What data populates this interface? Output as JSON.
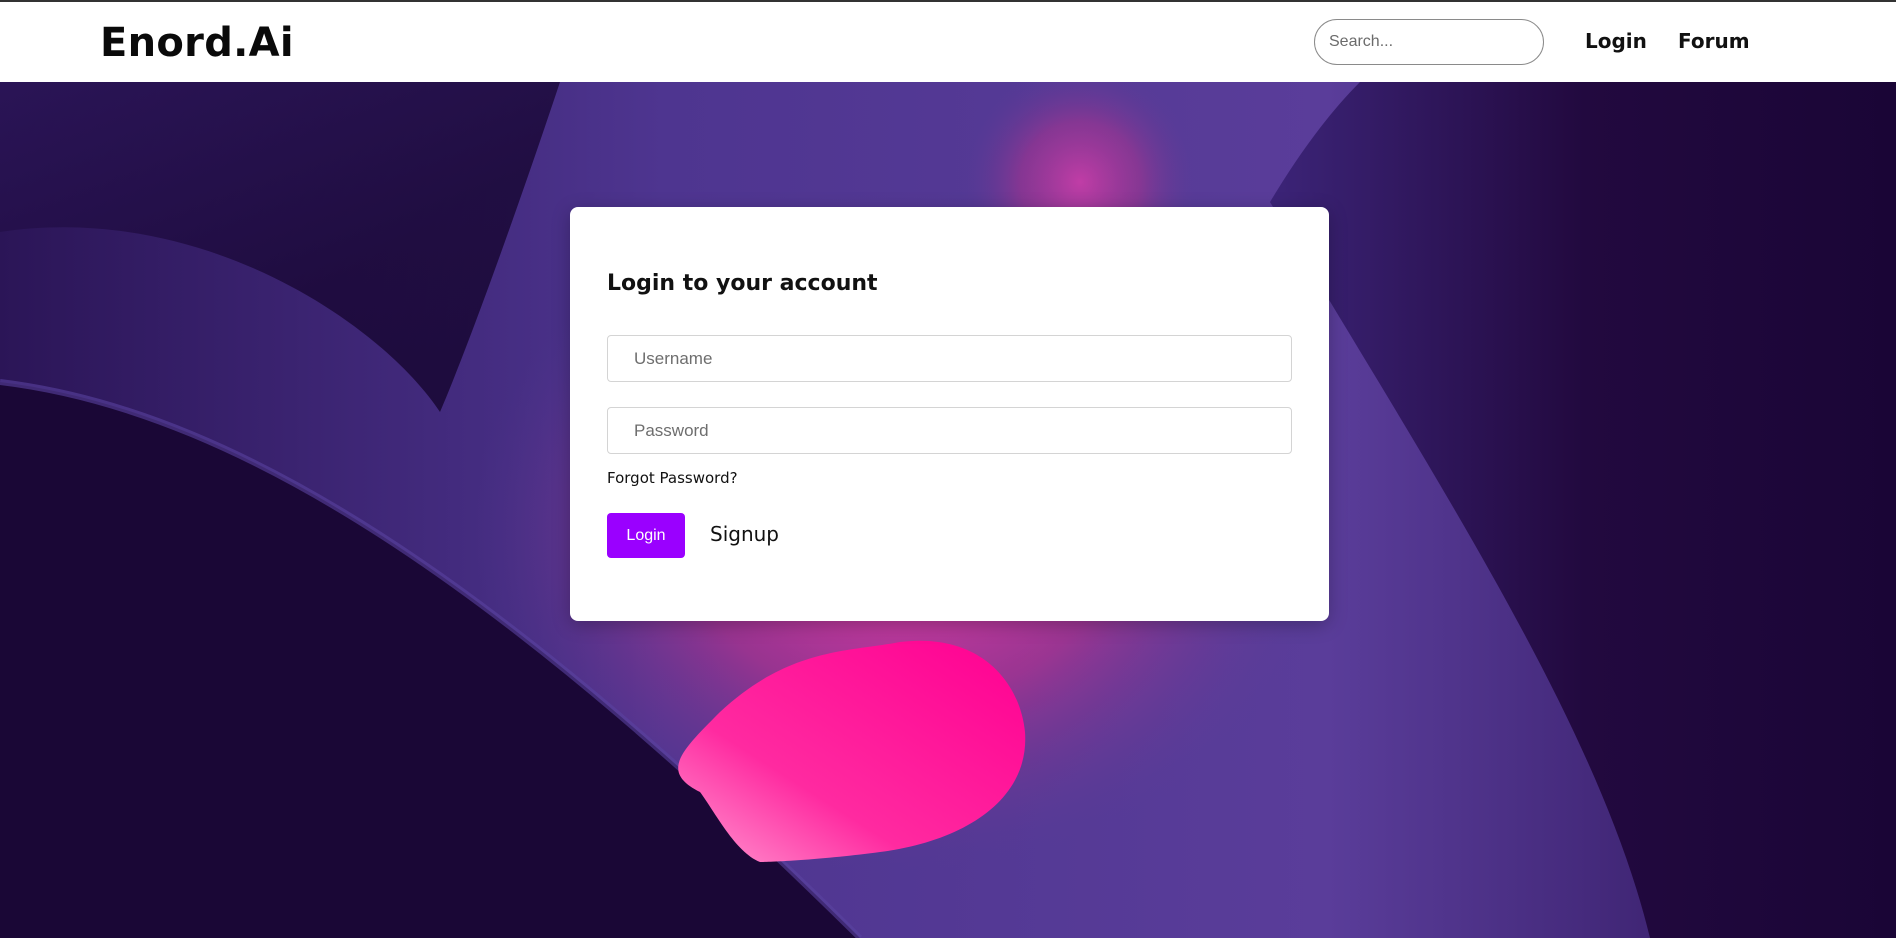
{
  "header": {
    "brand": "Enord.Ai",
    "search_placeholder": "Search...",
    "nav": [
      {
        "label": "Login"
      },
      {
        "label": "Forum"
      }
    ]
  },
  "login_card": {
    "title": "Login to your account",
    "username_placeholder": "Username",
    "password_placeholder": "Password",
    "forgot_label": "Forgot Password?",
    "login_button": "Login",
    "signup_label": "Signup"
  },
  "colors": {
    "accent": "#9a00ff",
    "background_dark": "#1c0a3d",
    "background_purple": "#573c96",
    "background_pink": "#ff0092"
  }
}
